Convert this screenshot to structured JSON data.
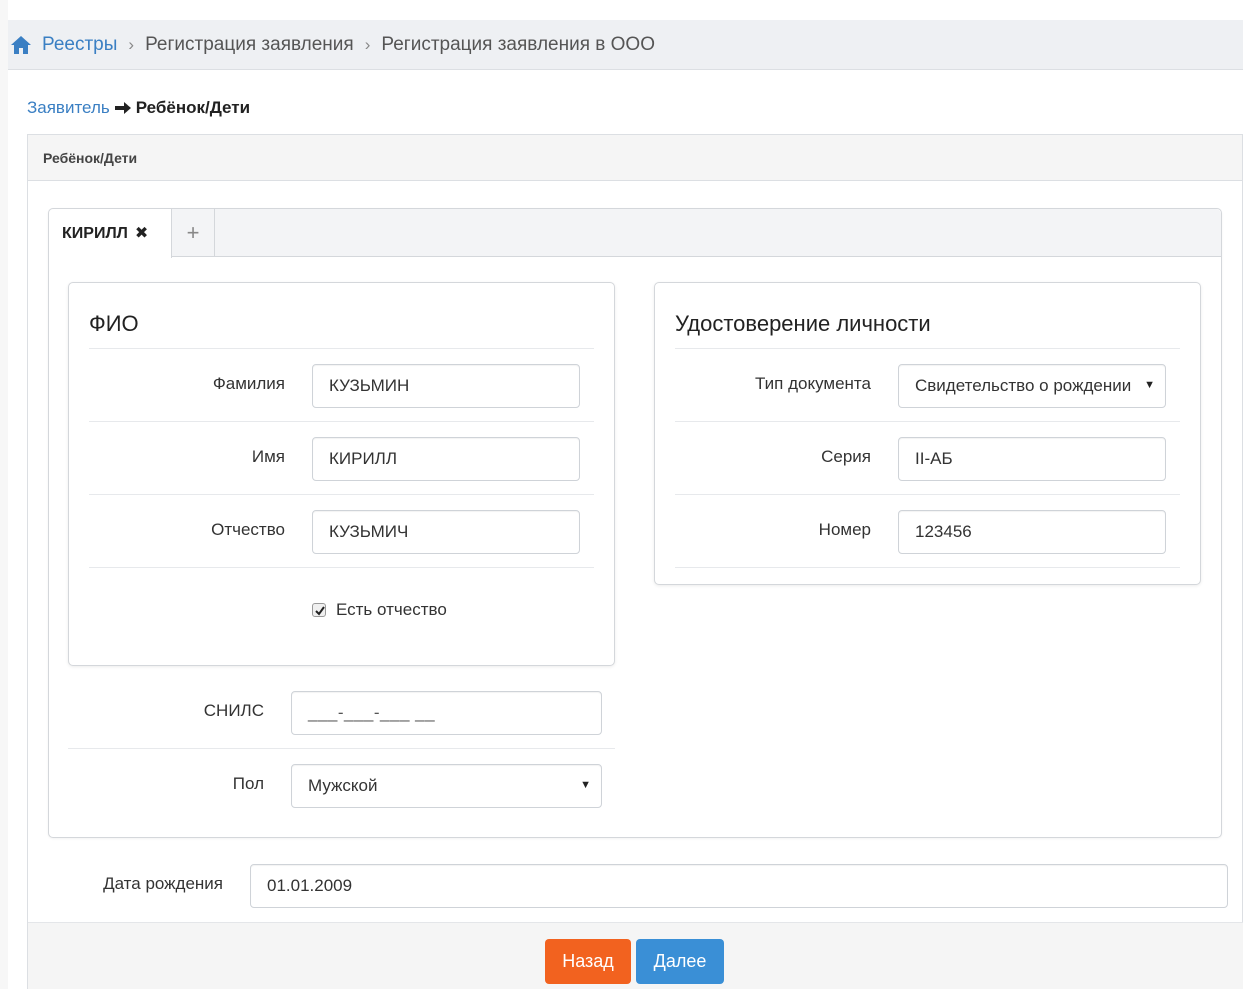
{
  "breadcrumb": {
    "items": [
      "Реестры",
      "Регистрация заявления",
      "Регистрация заявления в ООО"
    ]
  },
  "steps": {
    "previous": "Заявитель",
    "current": "Ребёнок/Дети"
  },
  "panel": {
    "heading": "Ребёнок/Дети"
  },
  "tabs": {
    "active_label": "КИРИЛЛ",
    "close_glyph": "✖",
    "add_glyph": "+"
  },
  "fio": {
    "title": "ФИО",
    "last_name_label": "Фамилия",
    "last_name_value": "КУЗЬМИН",
    "first_name_label": "Имя",
    "first_name_value": "КИРИЛЛ",
    "middle_name_label": "Отчество",
    "middle_name_value": "КУЗЬМИЧ",
    "has_middle_name_label": "Есть отчество",
    "has_middle_name_checked": true
  },
  "identity": {
    "title": "Удостоверение личности",
    "doc_type_label": "Тип документа",
    "doc_type_value": "Свидетельство о рождении",
    "series_label": "Серия",
    "series_value": "II-АБ",
    "number_label": "Номер",
    "number_value": "123456"
  },
  "snils": {
    "label": "СНИЛС",
    "placeholder": "___-___-___ __"
  },
  "gender": {
    "label": "Пол",
    "value": "Мужской"
  },
  "birth_date": {
    "label": "Дата рождения",
    "value": "01.01.2009"
  },
  "buttons": {
    "back": "Назад",
    "next": "Далее"
  },
  "colors": {
    "link": "#3a7fc3",
    "back_button": "#f2621f",
    "next_button": "#3a8fd6"
  }
}
